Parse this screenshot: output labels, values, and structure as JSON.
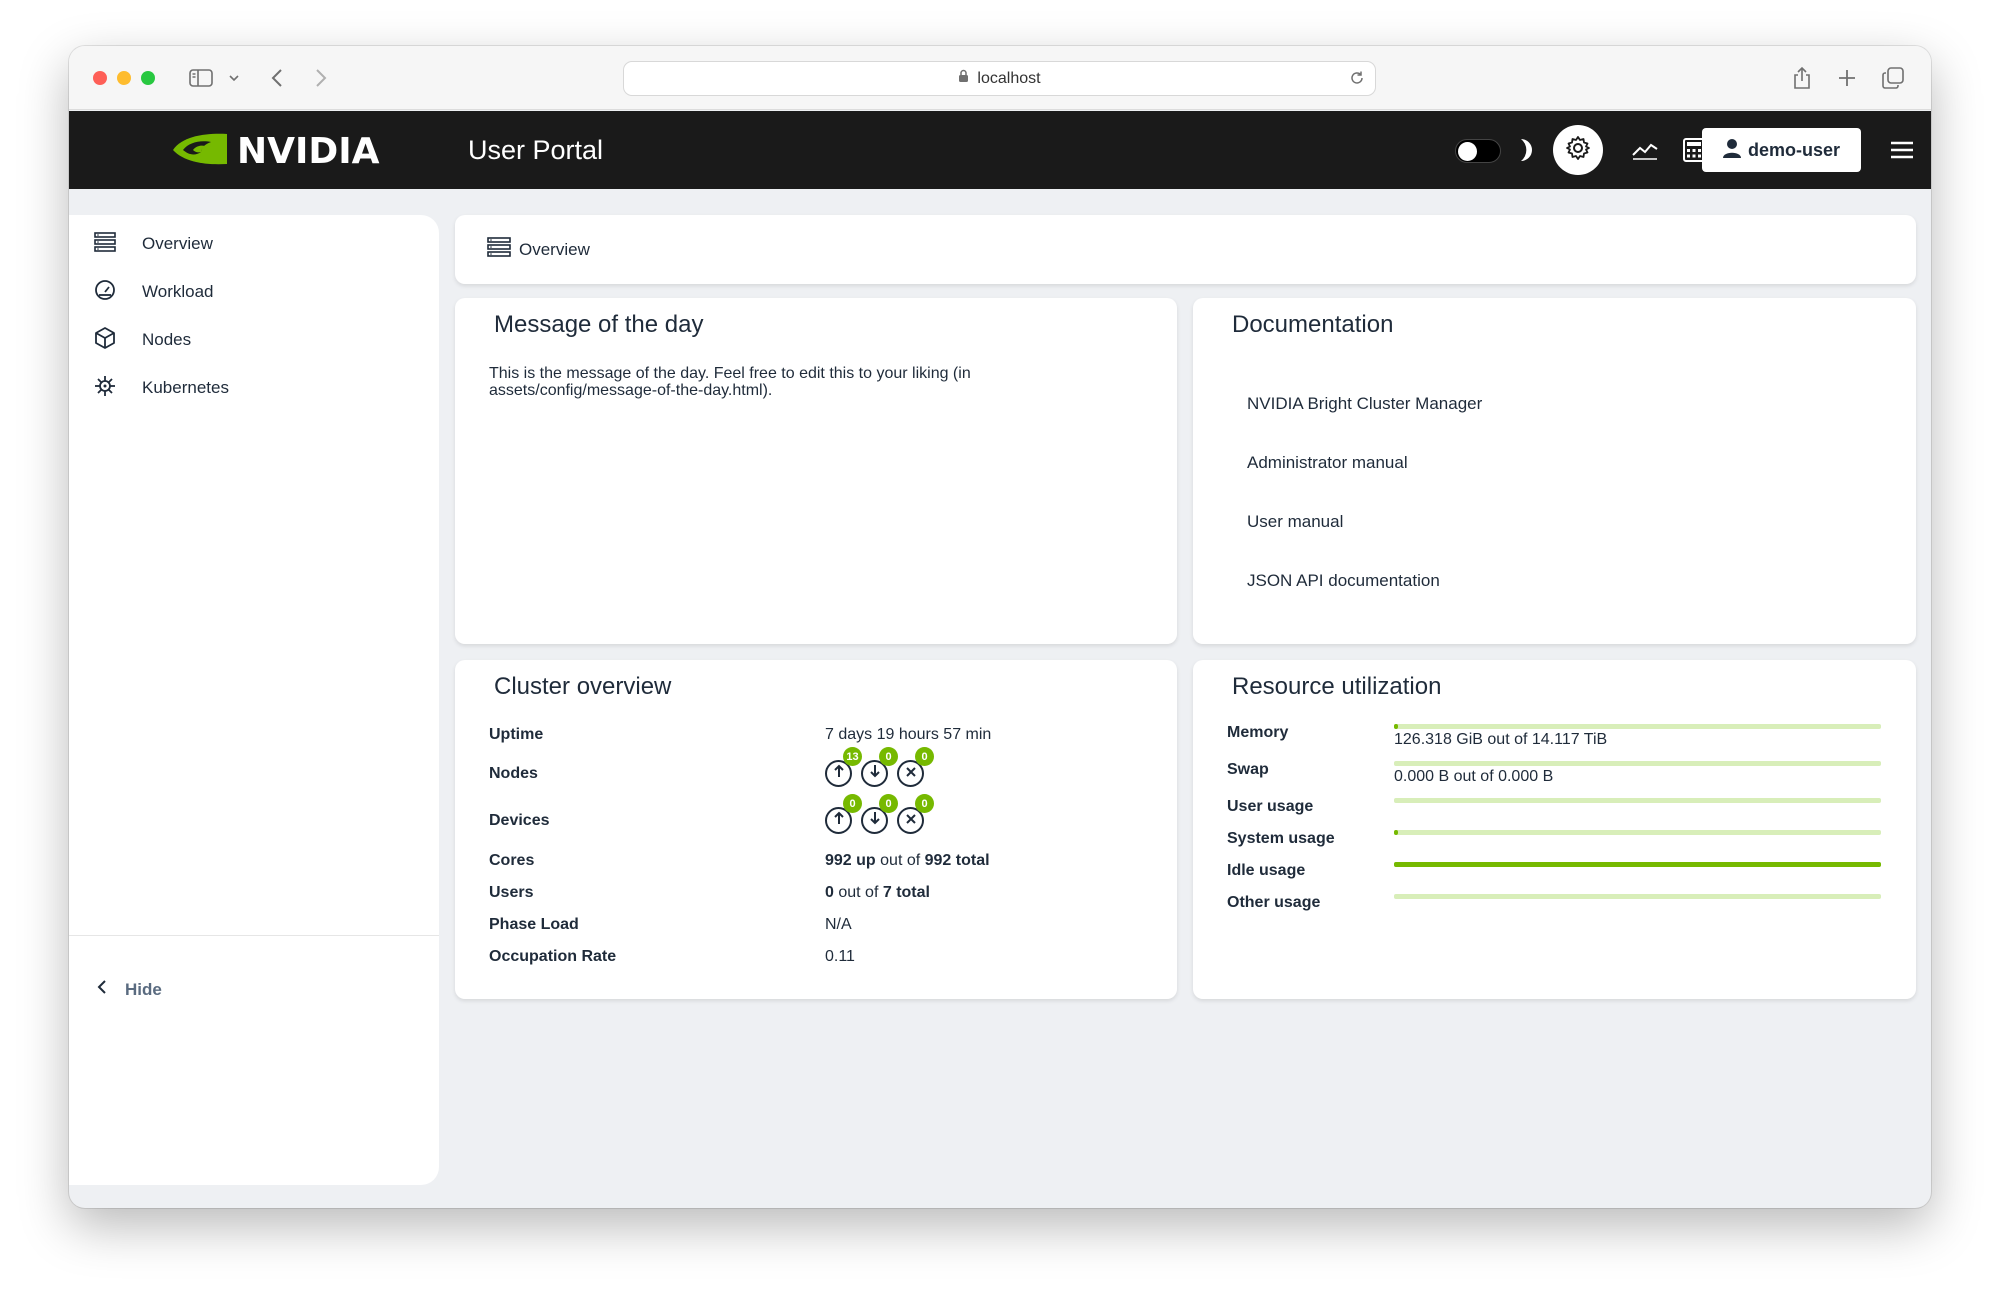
{
  "browser": {
    "url": "localhost"
  },
  "header": {
    "brand": "NVIDIA",
    "title": "User Portal",
    "user": "demo-user"
  },
  "sidebar": {
    "items": [
      {
        "label": "Overview",
        "icon": "server-stack-icon"
      },
      {
        "label": "Workload",
        "icon": "gauge-icon"
      },
      {
        "label": "Nodes",
        "icon": "cube-icon"
      },
      {
        "label": "Kubernetes",
        "icon": "helm-icon"
      }
    ],
    "hide_label": "Hide"
  },
  "breadcrumb": {
    "label": "Overview"
  },
  "motd": {
    "title": "Message of the day",
    "text": "This is the message of the day. Feel free to edit this to your liking (in assets/config/message-of-the-day.html)."
  },
  "documentation": {
    "title": "Documentation",
    "links": [
      "NVIDIA Bright Cluster Manager",
      "Administrator manual",
      "User manual",
      "JSON API documentation"
    ]
  },
  "cluster": {
    "title": "Cluster overview",
    "uptime_label": "Uptime",
    "uptime_value": "7 days 19 hours 57 min",
    "nodes_label": "Nodes",
    "nodes_counts": {
      "up": "13",
      "down": "0",
      "closed": "0"
    },
    "devices_label": "Devices",
    "devices_counts": {
      "up": "0",
      "down": "0",
      "closed": "0"
    },
    "cores_label": "Cores",
    "cores_up": "992 up",
    "cores_mid": "out of",
    "cores_total": "992 total",
    "users_label": "Users",
    "users_count": "0",
    "users_mid": "out of",
    "users_total": "7 total",
    "phase_label": "Phase Load",
    "phase_value": "N/A",
    "occupation_label": "Occupation Rate",
    "occupation_value": "0.11"
  },
  "resources": {
    "title": "Resource utilization",
    "rows": [
      {
        "label": "Memory",
        "text": "126.318 GiB out of 14.117 TiB",
        "fraction": 0.009
      },
      {
        "label": "Swap",
        "text": "0.000 B out of 0.000 B",
        "fraction": 0.0
      },
      {
        "label": "User usage",
        "text": "",
        "fraction": 0.0
      },
      {
        "label": "System usage",
        "text": "",
        "fraction": 0.002
      },
      {
        "label": "Idle usage",
        "text": "",
        "fraction": 1.0
      },
      {
        "label": "Other usage",
        "text": "",
        "fraction": 0.0
      }
    ]
  },
  "colors": {
    "accent": "#76b900",
    "header_bg": "#1a1a1a",
    "text": "#1f2b3a"
  }
}
